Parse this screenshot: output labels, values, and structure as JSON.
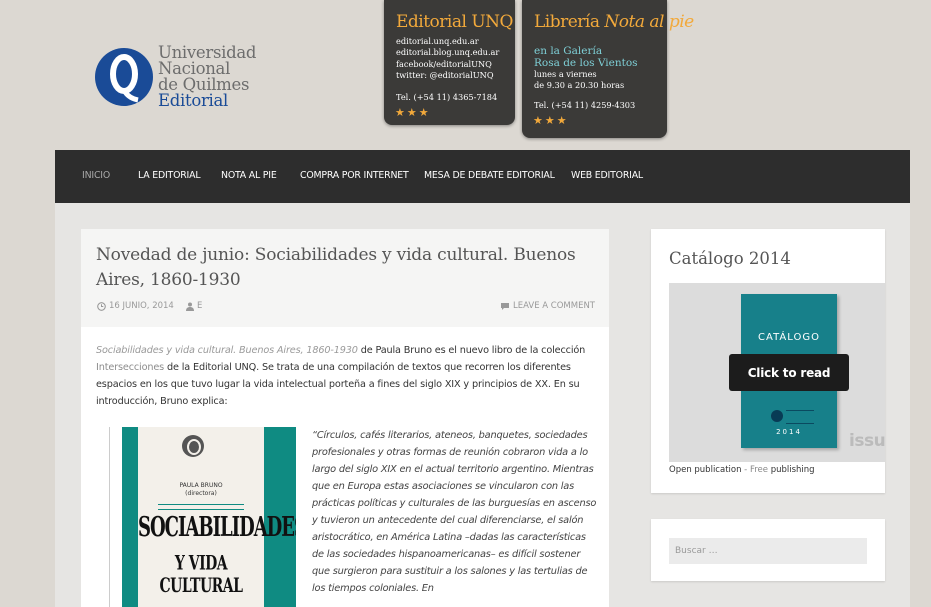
{
  "logo": {
    "line1": "Universidad",
    "line2": "Nacional",
    "line3": "de Quilmes",
    "line4": "Editorial"
  },
  "promo_editorial": {
    "title": "Editorial UNQ",
    "lines": [
      "editorial.unq.edu.ar",
      "editorial.blog.unq.edu.ar",
      "facebook/editorialUNQ",
      "twitter: @editorialUNQ"
    ],
    "phone": "Tel. (+54 11) 4365-7184",
    "stars": "★★★"
  },
  "promo_libreria": {
    "title_prefix": "Librería",
    "title_italic": "Nota al pie",
    "highlight1": "en la Galería",
    "highlight2": "Rosa de los Vientos",
    "line1": "lunes a viernes",
    "line2": "de 9.30 a 20.30 horas",
    "phone": "Tel. (+54 11) 4259-4303",
    "stars": "★★★"
  },
  "nav": {
    "items": [
      "INICIO",
      "LA EDITORIAL",
      "NOTA AL PIE",
      "COMPRA POR INTERNET",
      "MESA DE DEBATE EDITORIAL",
      "WEB EDITORIAL"
    ],
    "active": "INICIO"
  },
  "post": {
    "title": "Novedad de junio: Sociabilidades y vida cultural. Buenos Aires, 1860-1930",
    "date": "16 JUNIO, 2014",
    "author": "E",
    "comment": "LEAVE A COMMENT",
    "intro": {
      "book_title": "Sociabilidades y vida cultural. Buenos Aires, 1860-1930",
      "part1": " de Paula Bruno es el nuevo libro de la colección ",
      "collection": "Intersecciones",
      "part2": " de la Editorial UNQ. Se trata de una compilación de textos que recorren los diferentes espacios en los que tuvo lugar la vida intelectual porteña a fines del siglo XIX y principios de XX. En su introducción, Bruno explica:"
    },
    "cover": {
      "author": "PAULA BRUNO",
      "role": "(directora)",
      "title1": "SOCIABILIDADES",
      "title2": "Y VIDA CULTURAL"
    },
    "quote": "“Círculos, cafés literarios, ateneos, banquetes, sociedades profesionales y otras formas de reunión cobraron vida a lo largo del siglo XIX en el actual territorio argentino. Mientras que en Europa estas asociaciones se vincularon con las prácticas políticas y culturales de las burguesías en ascenso y tuvieron un antecedente del cual diferenciarse, el salón aristocrático, en América Latina –dadas las características de las sociedades hispanoamericanas– es difícil sostener que surgieron para sustituir a los salones y las tertulias de los tiempos coloniales. En"
  },
  "catalog": {
    "title": "Catálogo 2014",
    "book_label": "CATÁLOGO",
    "book_year": "2014",
    "read_button": "Click to read",
    "issuu_mark": "issu",
    "open_pub": "Open publication",
    "sep": " - ",
    "free": "Free",
    "publishing": " publishing"
  },
  "search": {
    "placeholder": "Buscar …",
    "value": ""
  },
  "colors": {
    "nav_bg": "#2d2d2d",
    "promo_bg": "#3b3a38",
    "promo_accent": "#f2a93b",
    "promo_highlight": "#7ecfd6",
    "logo_blue": "#1a4b97",
    "cover_teal": "#0f8b82"
  }
}
